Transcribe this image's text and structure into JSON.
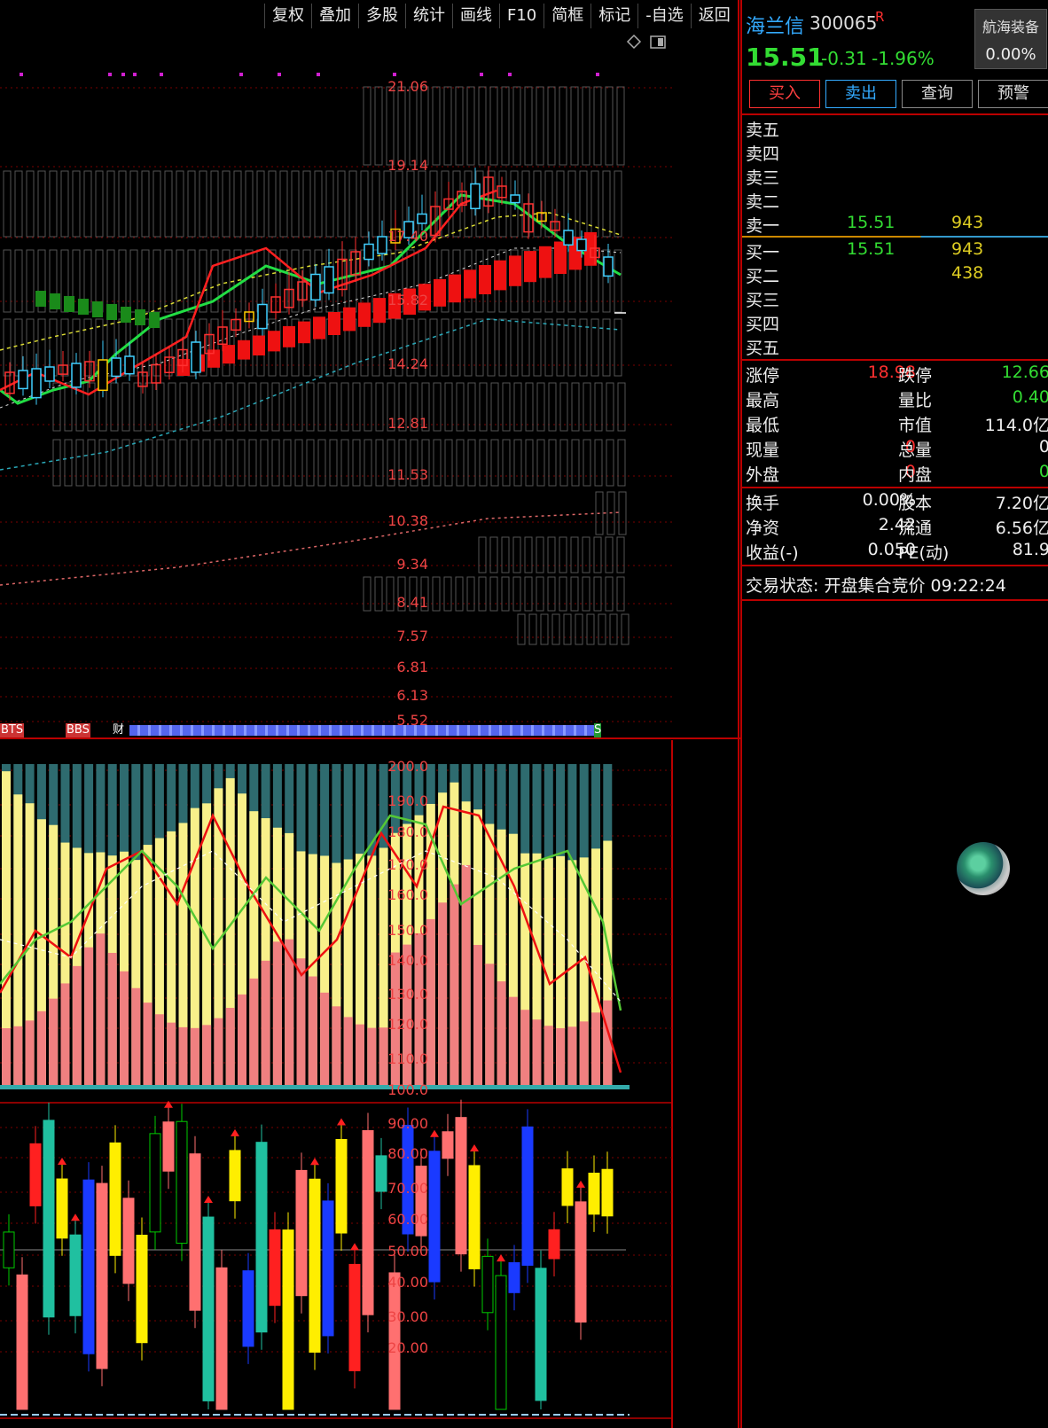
{
  "toolbar": [
    "复权",
    "叠加",
    "多股",
    "统计",
    "画线",
    "F10",
    "简框",
    "标记",
    "-自选",
    "返回"
  ],
  "price_axis": [
    "21.06",
    "19.14",
    "17.40",
    "15.82",
    "14.24",
    "12.81",
    "11.53",
    "10.38",
    "9.34",
    "8.41",
    "7.57",
    "6.81",
    "6.13",
    "5.52"
  ],
  "ind1_axis": [
    "200.0",
    "190.0",
    "180.0",
    "170.0",
    "160.0",
    "150.0",
    "140.0",
    "130.0",
    "120.0",
    "110.0",
    "100.0"
  ],
  "ind2_axis": [
    "90.00",
    "80.00",
    "70.00",
    "60.00",
    "50.00",
    "40.00",
    "30.00",
    "20.00"
  ],
  "signal_strip": {
    "left": "BTS",
    "mid": "BBS",
    "fin": "财",
    "end": "S"
  },
  "stock": {
    "name": "海兰信",
    "code": "300065",
    "flag": "R",
    "sector": "航海装备",
    "sector_pct": "0.00%",
    "price": "15.51",
    "change": "-0.31",
    "change_pct": "-1.96%"
  },
  "buttons": {
    "buy": "买入",
    "sell": "卖出",
    "query": "查询",
    "alert": "预警"
  },
  "order_book": {
    "asks": [
      {
        "label": "卖五",
        "price": "",
        "vol": ""
      },
      {
        "label": "卖四",
        "price": "",
        "vol": ""
      },
      {
        "label": "卖三",
        "price": "",
        "vol": ""
      },
      {
        "label": "卖二",
        "price": "",
        "vol": ""
      },
      {
        "label": "卖一",
        "price": "15.51",
        "vol": "943"
      }
    ],
    "bids": [
      {
        "label": "买一",
        "price": "15.51",
        "vol": "943"
      },
      {
        "label": "买二",
        "price": "",
        "vol": "438"
      },
      {
        "label": "买三",
        "price": "",
        "vol": ""
      },
      {
        "label": "买四",
        "price": "",
        "vol": ""
      },
      {
        "label": "买五",
        "price": "",
        "vol": ""
      }
    ]
  },
  "stats1": [
    {
      "l1": "涨停",
      "v1": "18.98",
      "l2": "跌停",
      "v2": "12.66"
    },
    {
      "l1": "最高",
      "v1": "",
      "l2": "量比",
      "v2": "0.40"
    },
    {
      "l1": "最低",
      "v1": "",
      "l2": "市值",
      "v2": "114.0亿"
    },
    {
      "l1": "现量",
      "v1": "0",
      "l2": "总量",
      "v2": "0"
    },
    {
      "l1": "外盘",
      "v1": "0",
      "l2": "内盘",
      "v2": "0"
    }
  ],
  "stats2": [
    {
      "l1": "换手",
      "v1": "0.00%",
      "l2": "股本",
      "v2": "7.20亿"
    },
    {
      "l1": "净资",
      "v1": "2.42",
      "l2": "流通",
      "v2": "6.56亿"
    },
    {
      "l1": "收益(-)",
      "v1": "0.050",
      "l2": "PE(动)",
      "v2": "81.9"
    }
  ],
  "trade_status": "交易状态: 开盘集合竞价 09:22:24",
  "colors": {
    "up": "#ff3030",
    "down": "#33dd33",
    "border": "#b00000",
    "accent": "#33aaff"
  }
}
